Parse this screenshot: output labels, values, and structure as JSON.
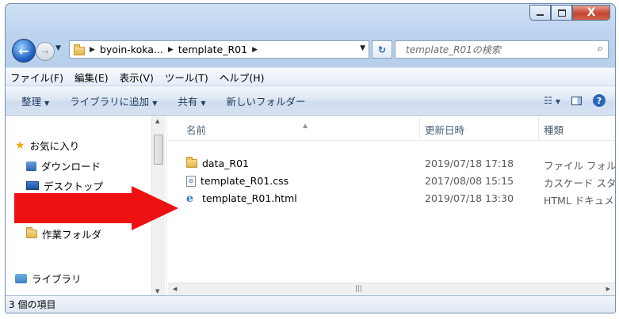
{
  "window": {
    "close_label": "X"
  },
  "address": {
    "crumbs": [
      "byoin-koka...",
      "template_R01"
    ]
  },
  "search": {
    "placeholder": "template_R01の検索"
  },
  "menu": [
    "ファイル(F)",
    "編集(E)",
    "表示(V)",
    "ツール(T)",
    "ヘルプ(H)"
  ],
  "toolbar": {
    "organize": "整理",
    "add_library": "ライブラリに追加",
    "share": "共有",
    "new_folder": "新しいフォルダー"
  },
  "nav": {
    "favorites": "お気に入り",
    "downloads": "ダウンロード",
    "desktop": "デスクトップ",
    "work_folder": "作業フォルダ",
    "library": "ライブラリ"
  },
  "columns": {
    "name": "名前",
    "date": "更新日時",
    "type": "種類"
  },
  "files": [
    {
      "name": "data_R01",
      "date": "2019/07/18 17:18",
      "type": "ファイル フォル"
    },
    {
      "name": "template_R01.css",
      "date": "2017/08/08 15:15",
      "type": "カスケード スタ"
    },
    {
      "name": "template_R01.html",
      "date": "2019/07/18 13:30",
      "type": "HTML ドキュメ"
    }
  ],
  "status": {
    "count_text": "3 個の項目"
  },
  "colors": {
    "arrow": "#ee1111",
    "close_button": "#c7452f",
    "accent": "#1f5fb3"
  }
}
